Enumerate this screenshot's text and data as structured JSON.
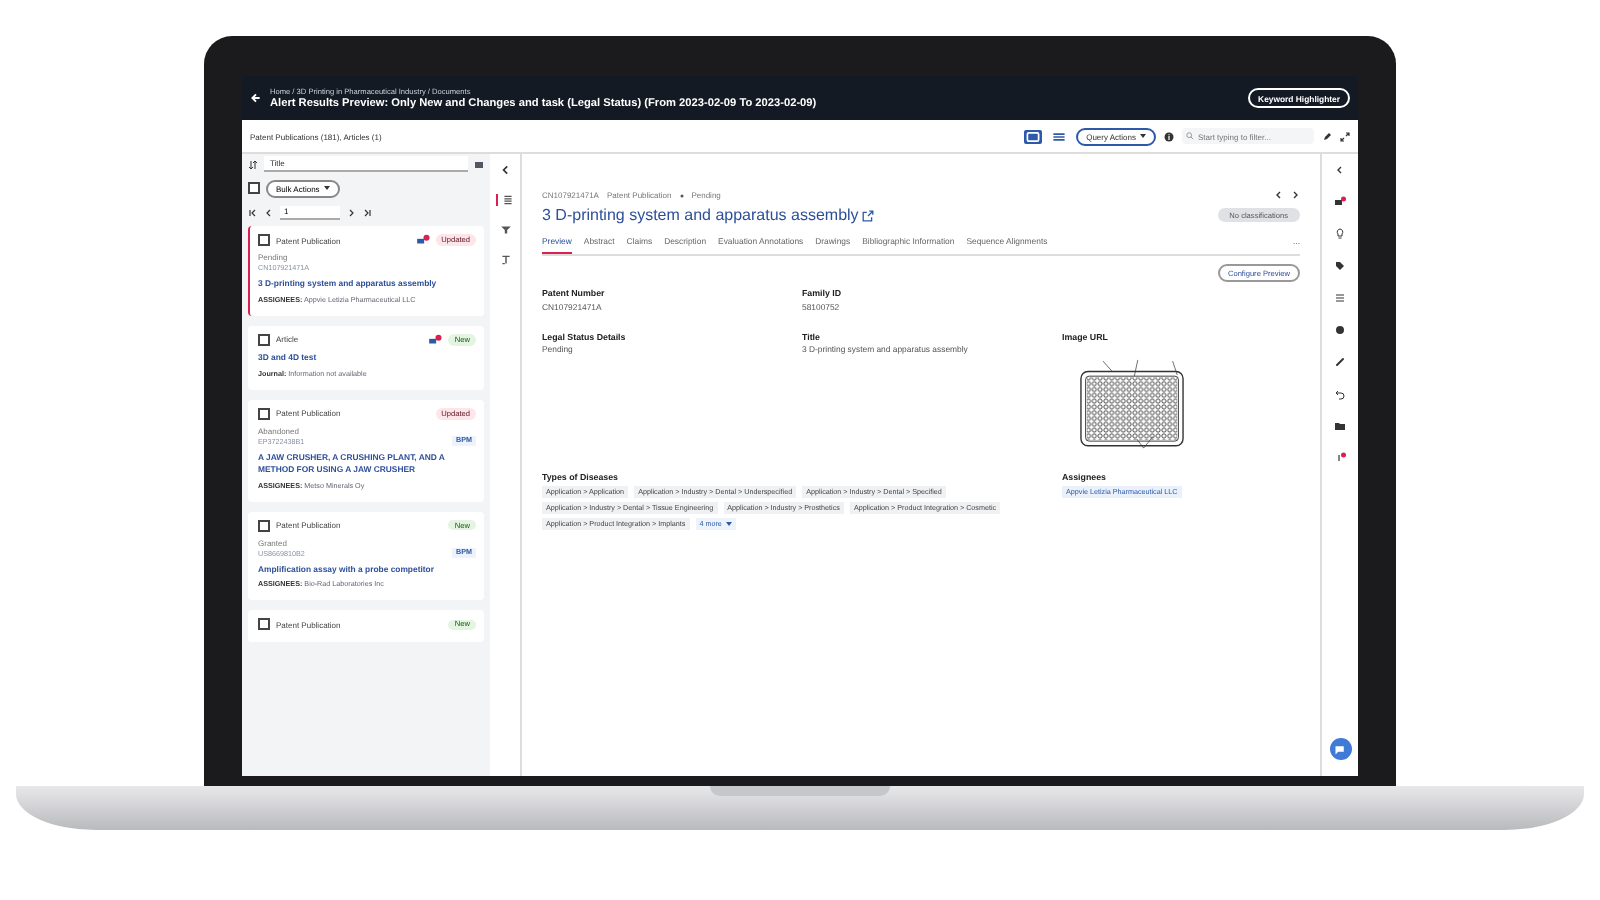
{
  "header": {
    "breadcrumb": "Home / 3D Printing in Pharmaceutical Industry / Documents",
    "title": "Alert Results Preview: Only New and Changes and task (Legal Status) (From 2023-02-09 To 2023-02-09)",
    "button": "Keyword Highlighter"
  },
  "toolbar": {
    "counts": "Patent Publications (181), Articles (1)",
    "views": [
      {
        "kind": "card",
        "selected": true
      },
      {
        "kind": "list",
        "selected": false
      }
    ],
    "query_actions": "Query Actions",
    "search": {
      "placeholder": "Start typing to filter..."
    }
  },
  "list_controls": {
    "sort": "Title",
    "select_all_checked": false,
    "bulk_actions": "Bulk Actions",
    "page": "1"
  },
  "cards": [
    {
      "type": "Patent Publication",
      "checked": false,
      "badge": {
        "label": "Updated",
        "color": "#fde6ea"
      },
      "status": "Pending",
      "number": "CN107921471A",
      "title": "3 D-printing system and apparatus assembly",
      "meta_label": "ASSIGNEES:",
      "meta": "Appvie Letizia Pharmaceutical LLC",
      "selected": true,
      "comments": true
    },
    {
      "type": "Article",
      "checked": false,
      "badge": {
        "label": "New",
        "color": "#e3f5e1"
      },
      "title": "3D and 4D test",
      "meta_label": "Journal:",
      "meta": "Information not available",
      "selected": false,
      "comments": true
    },
    {
      "type": "Patent Publication",
      "checked": false,
      "badge": {
        "label": "Updated",
        "color": "#fde6ea"
      },
      "status": "Abandoned",
      "number": "EP3722438B1",
      "tag": "BPM",
      "title": "A JAW CRUSHER, A CRUSHING PLANT, AND A METHOD FOR USING A JAW CRUSHER",
      "meta_label": "ASSIGNEES:",
      "meta": "Metso Minerals Oy",
      "selected": false,
      "comments": false
    },
    {
      "type": "Patent Publication",
      "checked": false,
      "badge": {
        "label": "New",
        "color": "#e3f5e1"
      },
      "status": "Granted",
      "number": "US8669810B2",
      "tag": "BPM",
      "title": "Amplification assay with a probe competitor",
      "meta_label": "ASSIGNEES:",
      "meta": "Bio-Rad Laboratories Inc",
      "selected": false,
      "comments": false
    },
    {
      "type": "Patent Publication",
      "checked": false,
      "badge": {
        "label": "New",
        "color": "#e3f5e1"
      },
      "selected": false,
      "comments": false
    }
  ],
  "main": {
    "id": "CN107921471A",
    "type": "Patent Publication",
    "status": "Pending",
    "classification": "No classifications",
    "title": "3 D-printing system and apparatus assembly",
    "tabs": [
      {
        "label": "Preview",
        "selected": true
      },
      {
        "label": "Abstract",
        "selected": false
      },
      {
        "label": "Claims",
        "selected": false
      },
      {
        "label": "Description",
        "selected": false
      },
      {
        "label": "Evaluation Annotations",
        "selected": false
      },
      {
        "label": "Drawings",
        "selected": false
      },
      {
        "label": "Bibliographic Information",
        "selected": false
      },
      {
        "label": "Sequence Alignments",
        "selected": false
      }
    ],
    "more": "...",
    "configure": "Configure Preview",
    "fields": [
      {
        "label": "Patent Number",
        "value": "CN107921471A"
      },
      {
        "label": "Family ID",
        "value": "58100752"
      },
      {
        "label": "Legal Status Details",
        "value": "Pending"
      },
      {
        "label": "Title",
        "value": "3 D-printing system and apparatus assembly"
      }
    ],
    "image_label": "Image URL",
    "diseases": {
      "label": "Types of Diseases",
      "chips": [
        "Application > Application",
        "Application > Industry > Dental > Underspecified",
        "Application > Industry > Dental > Specified",
        "Application > Industry > Dental > Tissue Engineering",
        "Application > Industry > Prosthetics",
        "Application > Product Integration > Cosmetic",
        "Application > Product Integration > Implants"
      ],
      "more": "4 more"
    },
    "assignees": {
      "label": "Assignees",
      "chips": [
        "Appvie Letizia Pharmaceutical LLC"
      ]
    }
  }
}
